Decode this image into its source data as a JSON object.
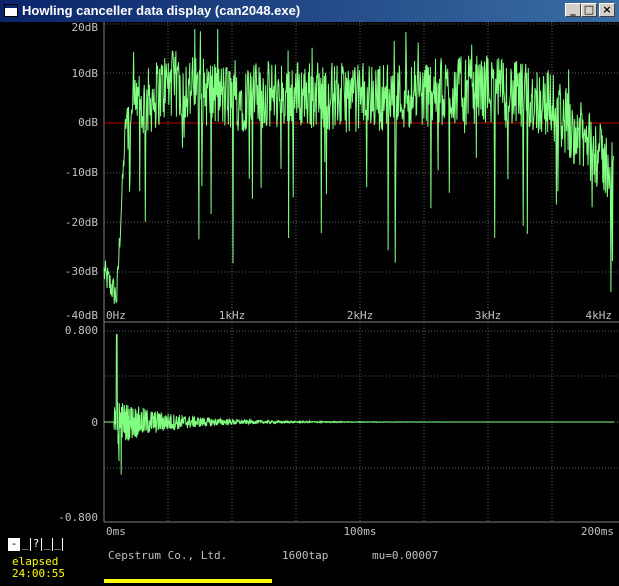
{
  "window": {
    "title": "Howling canceller data display (can2048.exe)",
    "buttons": [
      "_",
      "□",
      "×"
    ]
  },
  "spectrum": {
    "y_ticks": [
      "20dB",
      "10dB",
      "0dB",
      "-10dB",
      "-20dB",
      "-30dB",
      "-40dB"
    ],
    "x_ticks": [
      "0Hz",
      "1kHz",
      "2kHz",
      "3kHz",
      "4kHz"
    ],
    "zero_line_color": "#c00000",
    "trace_color": "#80ff80"
  },
  "impulse": {
    "y_ticks": [
      "0.800",
      "0",
      "-0.800"
    ],
    "x_ticks": [
      "0ms",
      "100ms",
      "200ms"
    ],
    "trace_color": "#80ff80"
  },
  "chart_data": [
    {
      "type": "line",
      "title": "",
      "xlabel": "",
      "ylabel": "",
      "xlim_hz": [
        0,
        4000
      ],
      "ylim_db": [
        -40,
        20
      ],
      "grid": true,
      "approx_envelope": [
        {
          "x": 0,
          "y": -30
        },
        {
          "x": 100,
          "y": -35
        },
        {
          "x": 170,
          "y": 0
        },
        {
          "x": 500,
          "y": 8
        },
        {
          "x": 1000,
          "y": 5
        },
        {
          "x": 1500,
          "y": 6
        },
        {
          "x": 2000,
          "y": 5
        },
        {
          "x": 2500,
          "y": 6
        },
        {
          "x": 3000,
          "y": 7
        },
        {
          "x": 3500,
          "y": 4
        },
        {
          "x": 4000,
          "y": -10
        }
      ]
    },
    {
      "type": "line",
      "title": "",
      "xlabel": "",
      "ylabel": "",
      "xlim_ms": [
        0,
        200
      ],
      "ylim": [
        -0.8,
        0.8
      ],
      "grid": true,
      "peak": {
        "x_ms": 5,
        "y": 0.76
      }
    }
  ],
  "footer": {
    "company": "Cepstrum Co., Ltd.",
    "taps": "1600tap",
    "mu": "mu=0.00007",
    "toolbar": [
      "-",
      "_",
      "?",
      "_",
      "_"
    ],
    "elapsed_label": "elapsed",
    "elapsed_time": "24:00:55"
  }
}
